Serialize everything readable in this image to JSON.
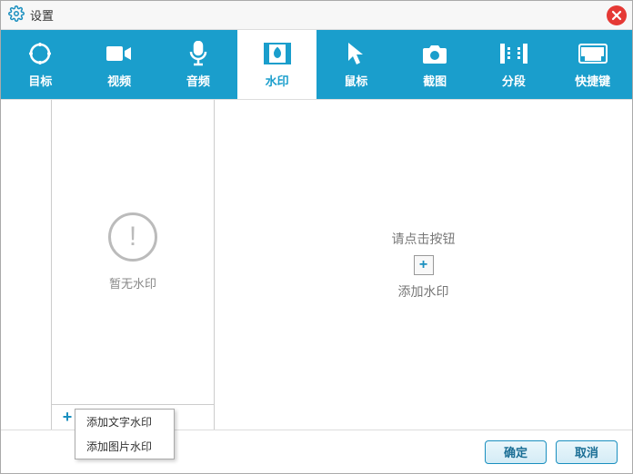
{
  "title": "设置",
  "tabs": [
    {
      "label": "目标",
      "icon": "target"
    },
    {
      "label": "视频",
      "icon": "video"
    },
    {
      "label": "音频",
      "icon": "audio"
    },
    {
      "label": "水印",
      "icon": "watermark"
    },
    {
      "label": "鼠标",
      "icon": "mouse"
    },
    {
      "label": "截图",
      "icon": "capture"
    },
    {
      "label": "分段",
      "icon": "segment"
    },
    {
      "label": "快捷键",
      "icon": "hotkey"
    }
  ],
  "active_tab": 3,
  "sidepanel": {
    "empty_text": "暂无水印",
    "toolbar": {
      "add": "+",
      "delete": "×",
      "up": "↑",
      "down": "↓"
    }
  },
  "popup": {
    "items": [
      "添加文字水印",
      "添加图片水印"
    ]
  },
  "main": {
    "hint_top": "请点击按钮",
    "hint_bottom": "添加水印"
  },
  "footer": {
    "ok": "确定",
    "cancel": "取消"
  }
}
